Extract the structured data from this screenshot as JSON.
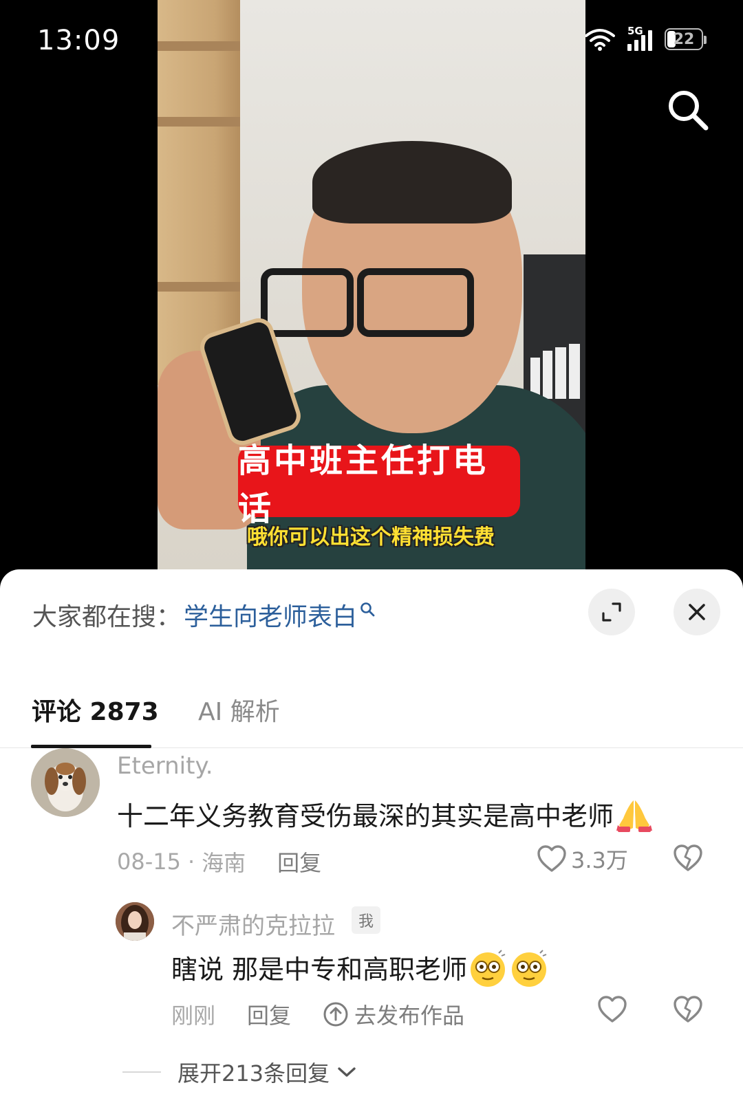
{
  "status_bar": {
    "time": "13:09",
    "network": "5G",
    "battery": "22"
  },
  "video": {
    "caption": "高中班主任打电话",
    "subtitle": "哦你可以出这个精神损失费"
  },
  "sheet": {
    "hot_search_label": "大家都在搜：",
    "hot_search_keyword": "学生向老师表白",
    "tabs": [
      {
        "label": "评论 2873",
        "active": true
      },
      {
        "label": "AI 解析",
        "active": false
      }
    ]
  },
  "comments": [
    {
      "author": "Eternity.",
      "content": "十二年义务教育受伤最深的其实是高中老师",
      "emoji": "pray-emoji",
      "date": "08-15",
      "separator": "·",
      "location": "海南",
      "reply_label": "回复",
      "likes": "3.3万"
    }
  ],
  "reply": {
    "author": "不严肃的克拉拉",
    "badge": "我",
    "content": "瞎说 那是中专和高职老师",
    "emoji": "dazed-face-emoji",
    "time": "刚刚",
    "reply_label": "回复",
    "publish_label": "去发布作品"
  },
  "expand_replies_label": "展开213条回复",
  "colors": {
    "accent_link": "#2c5f9b",
    "caption_red": "#e8151a",
    "subtitle_yellow": "#ffe033"
  }
}
